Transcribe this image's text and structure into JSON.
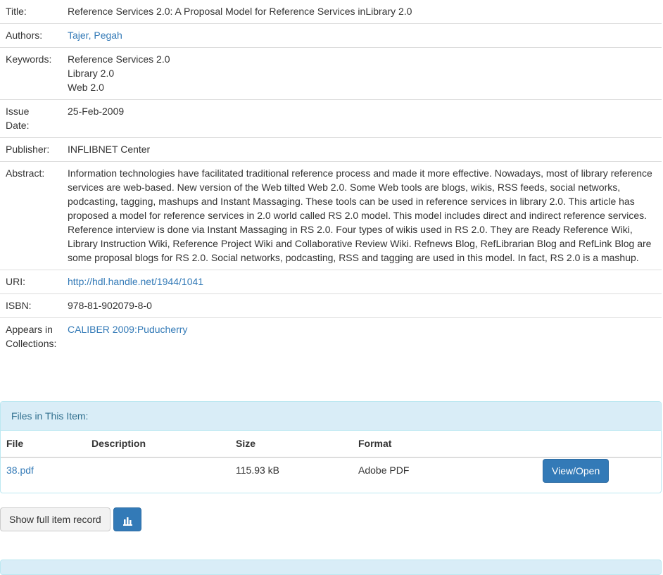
{
  "metadata": {
    "title_label": "Title:",
    "title_value": "Reference Services 2.0: A Proposal Model for Reference Services inLibrary 2.0",
    "authors_label": "Authors:",
    "authors_value": "Tajer, Pegah",
    "keywords_label": "Keywords:",
    "keywords": [
      "Reference Services 2.0",
      "Library 2.0",
      "Web 2.0"
    ],
    "issue_date_label_1": "Issue",
    "issue_date_label_2": "Date:",
    "issue_date_value": "25-Feb-2009",
    "publisher_label": "Publisher:",
    "publisher_value": "INFLIBNET Center",
    "abstract_label": "Abstract:",
    "abstract_lines": [
      "Information technologies have facilitated traditional reference process and made it more effective. Nowadays, most of library reference",
      "services are web-based. New version of the Web tilted Web 2.0. Some Web tools are blogs, wikis, RSS feeds, social networks,",
      "podcasting, tagging, mashups and Instant Massaging. These tools can be used in reference services in library 2.0. This article has",
      "proposed a model for reference services in 2.0 world called RS 2.0 model. This model includes direct and indirect reference services.",
      "Reference interview is done via Instant Massaging in RS 2.0. Four types of wikis used in RS 2.0. They are Ready Reference Wiki,",
      "Library Instruction Wiki, Reference Project Wiki and Collaborative Review Wiki. Refnews Blog, RefLibrarian Blog and RefLink Blog are",
      "some proposal blogs for RS 2.0. Social networks, podcasting, RSS and tagging are used in this model. In fact, RS 2.0 is a mashup."
    ],
    "uri_label": "URI:",
    "uri_value": "http://hdl.handle.net/1944/1041",
    "isbn_label": "ISBN:",
    "isbn_value": "978-81-902079-8-0",
    "collections_label_1": "Appears in",
    "collections_label_2": "Collections:",
    "collections_value": "CALIBER 2009:Puducherry"
  },
  "files": {
    "heading": "Files in This Item:",
    "columns": [
      "File",
      "Description",
      "Size",
      "Format"
    ],
    "rows": [
      {
        "file": "38.pdf",
        "description": "",
        "size": "115.93 kB",
        "format": "Adobe PDF",
        "action": "View/Open"
      }
    ]
  },
  "actions": {
    "show_full_record": "Show full item record",
    "stats_icon": "bar-chart-icon"
  },
  "colors": {
    "link": "#337ab7",
    "primary": "#337ab7",
    "panel_heading_bg": "#d9edf7",
    "panel_heading_text": "#31708f"
  }
}
